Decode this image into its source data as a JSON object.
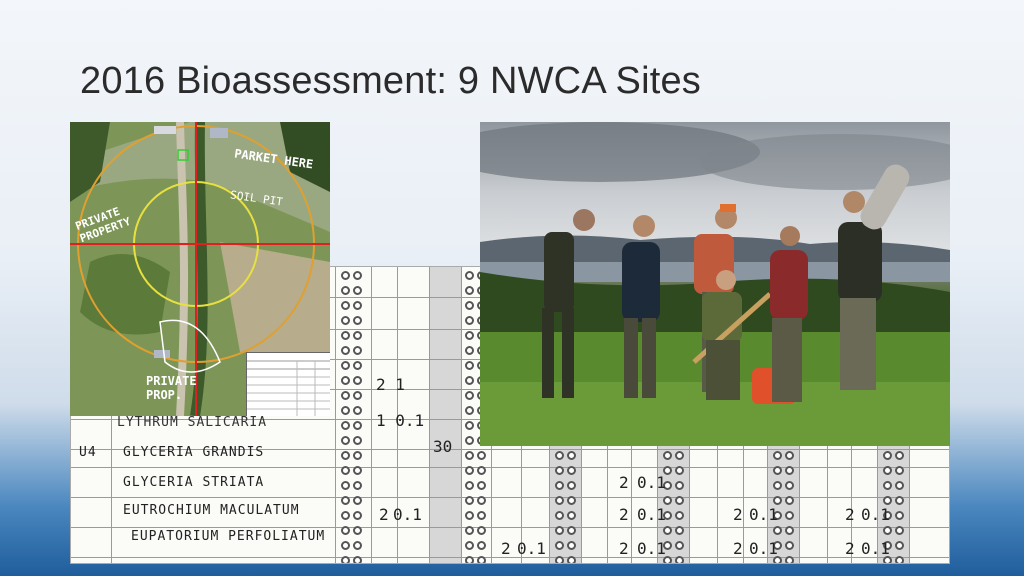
{
  "slide": {
    "title": "2016 Bioassessment: 9 NWCA Sites"
  },
  "map": {
    "annotations": [
      "PARKET HERE",
      "SOIL PIT",
      "PRIVATE PROPERTY",
      "PRIVATE PROP."
    ]
  },
  "datasheet": {
    "rows": [
      {
        "code": "U4",
        "species": "GLYCERIA GRANDIS",
        "values": [
          "30"
        ]
      },
      {
        "code": "",
        "species": "GLYCERIA STRIATA",
        "values": [
          "2",
          "0.1"
        ]
      },
      {
        "code": "",
        "species": "EUTROCHIUM MACULATUM",
        "values": [
          "2",
          "0.1",
          "2",
          "0.1",
          "2",
          "0.1",
          "2",
          "0.1"
        ]
      },
      {
        "code": "",
        "species": "EUPATORIUM PERFOLIATUM",
        "values": [
          "2",
          "0.1",
          "2",
          "0.1",
          "2",
          "0.1",
          "2",
          "0.1"
        ]
      }
    ],
    "top_values": [
      "2 1",
      "1 0.1"
    ],
    "partial_top": "LYTHRUM SALICARIA"
  },
  "colors": {
    "title": "#2b2b2b",
    "band_dark": "#1f5d9c"
  }
}
